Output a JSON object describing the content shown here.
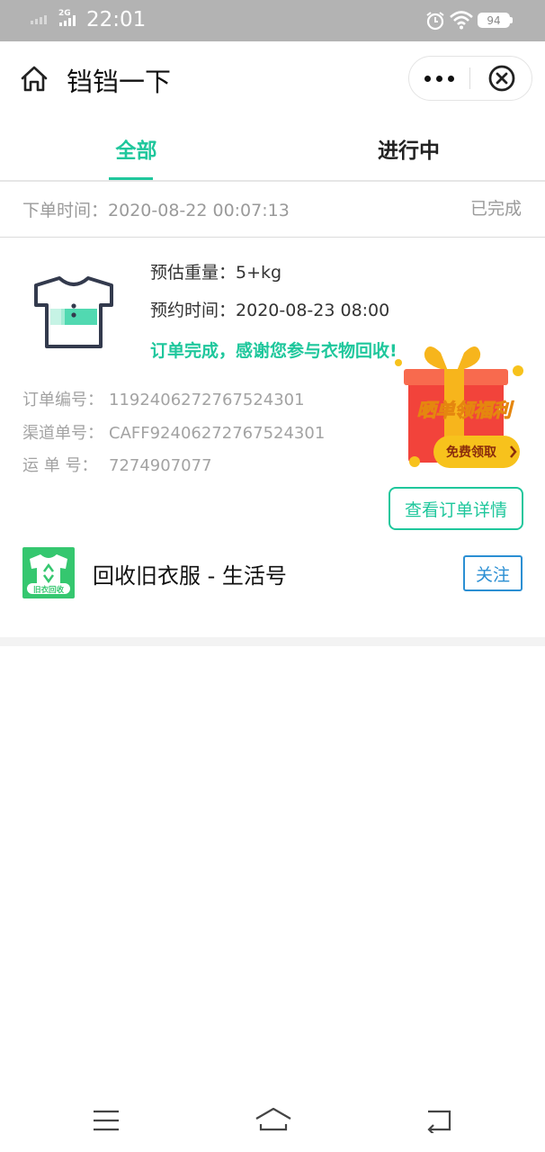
{
  "status_bar": {
    "network": "2G",
    "time": "22:01",
    "battery": "94",
    "icons": [
      "signal-icon",
      "alarm-icon",
      "wifi-icon",
      "battery-icon"
    ]
  },
  "title_bar": {
    "title": "铛铛一下",
    "icons": [
      "home-icon",
      "more-icon",
      "close-icon"
    ]
  },
  "tabs": [
    {
      "label": "全部",
      "active": true
    },
    {
      "label": "进行中",
      "active": false
    }
  ],
  "order": {
    "time_label": "下单时间：",
    "time_value": "2020-08-22 00:07:13",
    "status": "已完成",
    "weight_label": "预估重量：",
    "weight_value": "5+kg",
    "appointment_label": "预约时间：",
    "appointment_value": "2020-08-23 08:00",
    "completion_message": "订单完成，感谢您参与衣物回收!",
    "order_no_label": "订单编号：",
    "order_no": "1192406272767524301",
    "channel_no_label": "渠道单号：",
    "channel_no": "CAFF92406272767524301",
    "waybill_label": "运 单 号：",
    "waybill_no": "7274907077",
    "detail_button": "查看订单详情"
  },
  "gift_banner": {
    "title": "晒单领福利",
    "button": "免费领取"
  },
  "official_account": {
    "logo_text": "旧衣回收",
    "name": "回收旧衣服 - 生活号",
    "follow_button": "关注"
  },
  "colors": {
    "accent": "#1fc79c",
    "link_blue": "#2b8fd3",
    "status_bar": "#b3b3b3",
    "gift_red": "#f2433b",
    "gift_gold": "#f7b51c"
  },
  "nav_bar": {
    "icons": [
      "menu-icon",
      "home-outline-icon",
      "back-icon"
    ]
  }
}
